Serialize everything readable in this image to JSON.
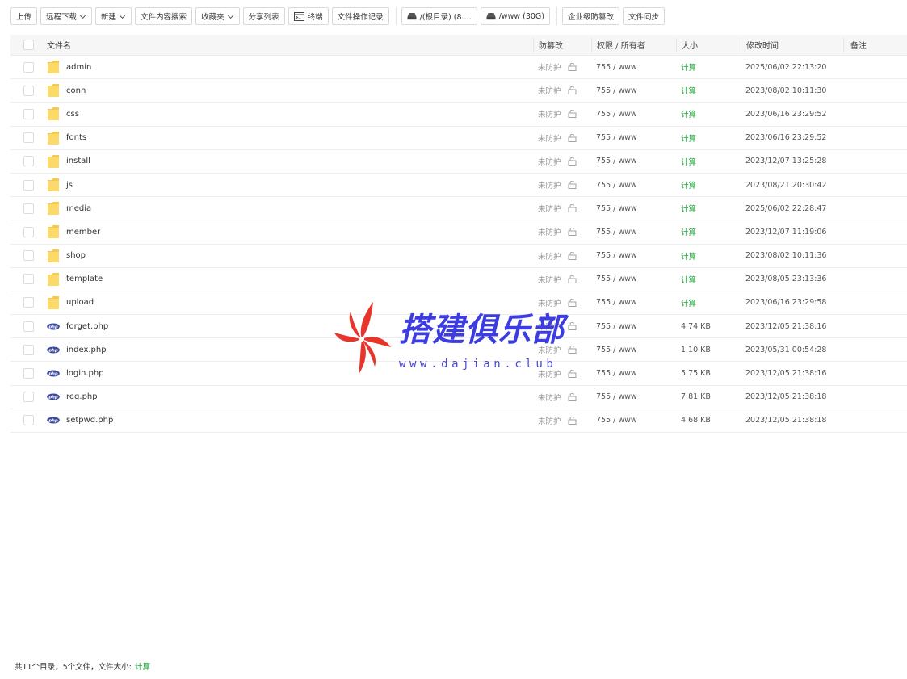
{
  "toolbar": {
    "buttons": [
      {
        "label": "上传"
      },
      {
        "label": "远程下载"
      },
      {
        "label": "新建"
      },
      {
        "label": "文件内容搜索"
      },
      {
        "label": "收藏夹"
      },
      {
        "label": "分享列表"
      },
      {
        "label": "终端"
      },
      {
        "label": "文件操作记录"
      },
      {
        "label": "/(根目录) (8...."
      },
      {
        "label": "/www (30G)"
      },
      {
        "label": "企业级防篡改"
      },
      {
        "label": "文件同步"
      }
    ]
  },
  "table": {
    "headers": {
      "name": "文件名",
      "protect": "防篡改",
      "perm": "权限 / 所有者",
      "size": "大小",
      "mtime": "修改时间",
      "note": "备注"
    },
    "rows": [
      {
        "icon": "folder-icon",
        "name": "admin",
        "protect": "未防护",
        "perm": "755 / www",
        "size": "计算",
        "mtime": "2025/06/02 22:13:20"
      },
      {
        "icon": "folder-icon",
        "name": "conn",
        "protect": "未防护",
        "perm": "755 / www",
        "size": "计算",
        "mtime": "2023/08/02 10:11:30"
      },
      {
        "icon": "folder-icon",
        "name": "css",
        "protect": "未防护",
        "perm": "755 / www",
        "size": "计算",
        "mtime": "2023/06/16 23:29:52"
      },
      {
        "icon": "folder-icon",
        "name": "fonts",
        "protect": "未防护",
        "perm": "755 / www",
        "size": "计算",
        "mtime": "2023/06/16 23:29:52"
      },
      {
        "icon": "folder-icon",
        "name": "install",
        "protect": "未防护",
        "perm": "755 / www",
        "size": "计算",
        "mtime": "2023/12/07 13:25:28"
      },
      {
        "icon": "folder-icon",
        "name": "js",
        "protect": "未防护",
        "perm": "755 / www",
        "size": "计算",
        "mtime": "2023/08/21 20:30:42"
      },
      {
        "icon": "folder-icon",
        "name": "media",
        "protect": "未防护",
        "perm": "755 / www",
        "size": "计算",
        "mtime": "2025/06/02 22:28:47"
      },
      {
        "icon": "folder-icon",
        "name": "member",
        "protect": "未防护",
        "perm": "755 / www",
        "size": "计算",
        "mtime": "2023/12/07 11:19:06"
      },
      {
        "icon": "folder-icon",
        "name": "shop",
        "protect": "未防护",
        "perm": "755 / www",
        "size": "计算",
        "mtime": "2023/08/02 10:11:36"
      },
      {
        "icon": "folder-icon",
        "name": "template",
        "protect": "未防护",
        "perm": "755 / www",
        "size": "计算",
        "mtime": "2023/08/05 23:13:36"
      },
      {
        "icon": "folder-icon",
        "name": "upload",
        "protect": "未防护",
        "perm": "755 / www",
        "size": "计算",
        "mtime": "2023/06/16 23:29:58"
      },
      {
        "icon": "php-file-icon",
        "name": "forget.php",
        "protect": "未防护",
        "perm": "755 / www",
        "size": "4.74 KB",
        "mtime": "2023/12/05 21:38:16"
      },
      {
        "icon": "php-file-icon",
        "name": "index.php",
        "protect": "未防护",
        "perm": "755 / www",
        "size": "1.10 KB",
        "mtime": "2023/05/31 00:54:28"
      },
      {
        "icon": "php-file-icon",
        "name": "login.php",
        "protect": "未防护",
        "perm": "755 / www",
        "size": "5.75 KB",
        "mtime": "2023/12/05 21:38:16"
      },
      {
        "icon": "php-file-icon",
        "name": "reg.php",
        "protect": "未防护",
        "perm": "755 / www",
        "size": "7.81 KB",
        "mtime": "2023/12/05 21:38:18"
      },
      {
        "icon": "php-file-icon",
        "name": "setpwd.php",
        "protect": "未防护",
        "perm": "755 / www",
        "size": "4.68 KB",
        "mtime": "2023/12/05 21:38:18"
      }
    ]
  },
  "footer": {
    "summary": "共11个目录，5个文件，文件大小:",
    "calc_label": "计算"
  },
  "watermark": {
    "title": "搭建俱乐部",
    "url": "www.dajian.club"
  },
  "colors": {
    "accent_green": "#20a53a",
    "folder_yellow": "#f7c948",
    "php_blue": "#3b4a9c",
    "watermark_blue": "#3c3ce0",
    "watermark_red": "#e8352b"
  }
}
